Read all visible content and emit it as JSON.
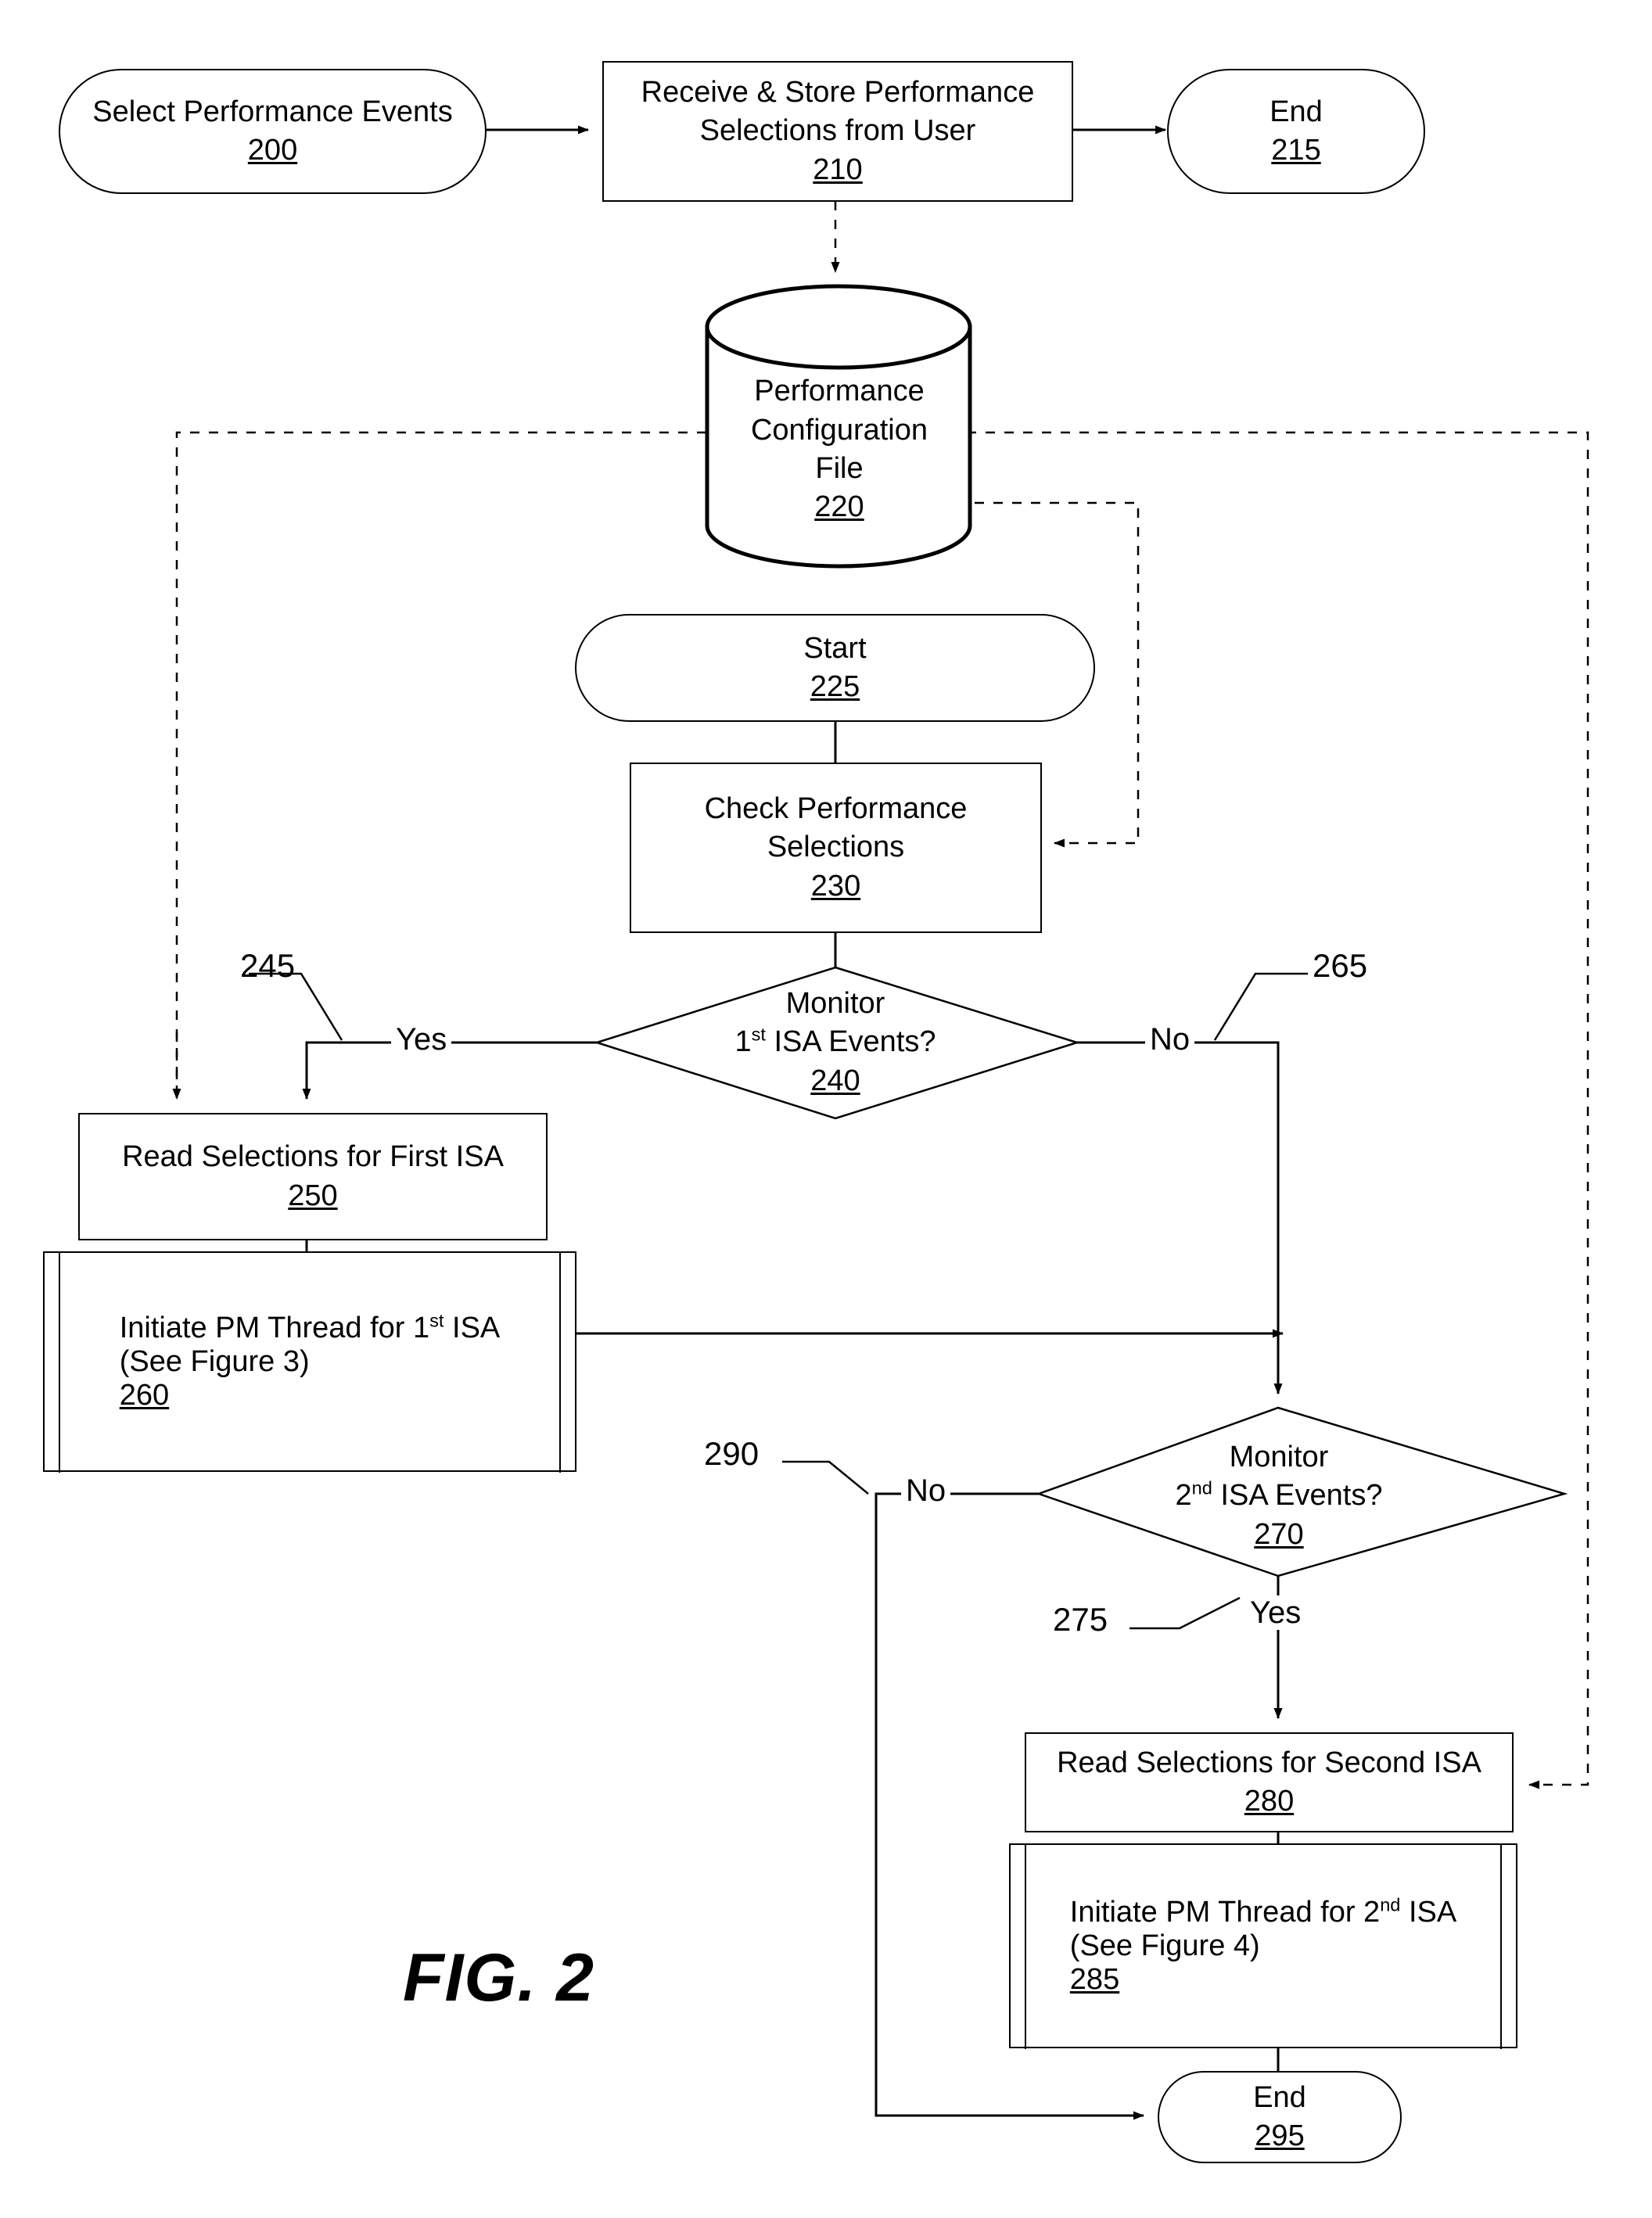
{
  "figure": {
    "caption": "FIG. 2",
    "title": "Performance monitoring configuration flowchart"
  },
  "nodes": {
    "n200": {
      "shape": "terminator",
      "line1": "Select Performance Events",
      "ref": "200"
    },
    "n210": {
      "shape": "process",
      "line1": "Receive & Store Performance",
      "line2": "Selections from User",
      "ref": "210"
    },
    "n215": {
      "shape": "terminator",
      "line1": "End",
      "ref": "215"
    },
    "n220": {
      "shape": "database",
      "line1": "Performance",
      "line2": "Configuration",
      "line3": "File",
      "ref": "220"
    },
    "n225": {
      "shape": "terminator",
      "line1": "Start",
      "ref": "225"
    },
    "n230": {
      "shape": "process",
      "line1": "Check Performance",
      "line2": "Selections",
      "ref": "230"
    },
    "n240": {
      "shape": "decision",
      "line1": "Monitor",
      "line2_pre": "1",
      "line2_sup": "st",
      "line2_post": " ISA Events?",
      "ref": "240"
    },
    "n250": {
      "shape": "process",
      "line1": "Read Selections for First ISA",
      "ref": "250"
    },
    "n260": {
      "shape": "predefined",
      "line1_pre": "Initiate PM Thread for 1",
      "line1_sup": "st",
      "line1_post": " ISA",
      "line2": "(See Figure 3)",
      "ref": "260"
    },
    "n270": {
      "shape": "decision",
      "line1": "Monitor",
      "line2_pre": "2",
      "line2_sup": "nd",
      "line2_post": " ISA Events?",
      "ref": "270"
    },
    "n280": {
      "shape": "process",
      "line1": "Read Selections for Second ISA",
      "ref": "280"
    },
    "n285": {
      "shape": "predefined",
      "line1_pre": "Initiate PM Thread for 2",
      "line1_sup": "nd",
      "line1_post": " ISA",
      "line2": "(See Figure 4)",
      "ref": "285"
    },
    "n295": {
      "shape": "terminator",
      "line1": "End",
      "ref": "295"
    }
  },
  "edge_labels": {
    "yes_240": "Yes",
    "no_240": "No",
    "no_270": "No",
    "yes_270": "Yes"
  },
  "reference_numerals": {
    "r245": "245",
    "r265": "265",
    "r290": "290",
    "r275": "275"
  },
  "colors": {
    "stroke": "#000000",
    "background": "#ffffff"
  }
}
